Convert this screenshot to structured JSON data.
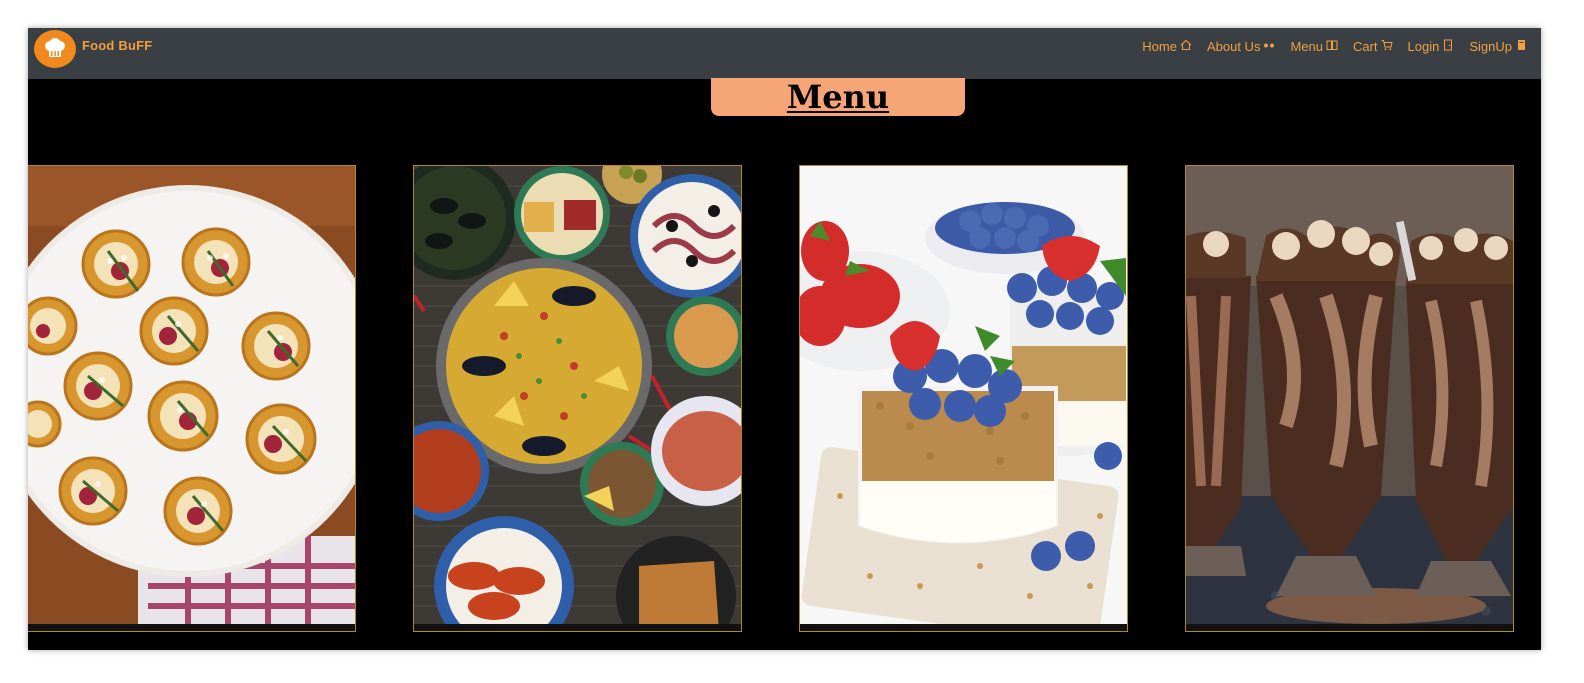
{
  "brand": {
    "name": "Food BuFF",
    "logo_icon": "chef-hat-icon",
    "color": "#f0a040"
  },
  "nav": {
    "items": [
      {
        "label": "Home",
        "icon": "home-icon"
      },
      {
        "label": "About Us",
        "icon": "dots-icon"
      },
      {
        "label": "Menu",
        "icon": "book-icon"
      },
      {
        "label": "Cart",
        "icon": "cart-icon"
      },
      {
        "label": "Login",
        "icon": "door-icon"
      },
      {
        "label": "SignUp",
        "icon": "signup-icon"
      }
    ]
  },
  "heading": {
    "title": "Menu",
    "bg_color": "#f6a576"
  },
  "cards": [
    {
      "image": "appetizer-tarts-image"
    },
    {
      "image": "spanish-tapas-image"
    },
    {
      "image": "berry-parfait-image"
    },
    {
      "image": "chocolate-milkshake-image"
    }
  ]
}
